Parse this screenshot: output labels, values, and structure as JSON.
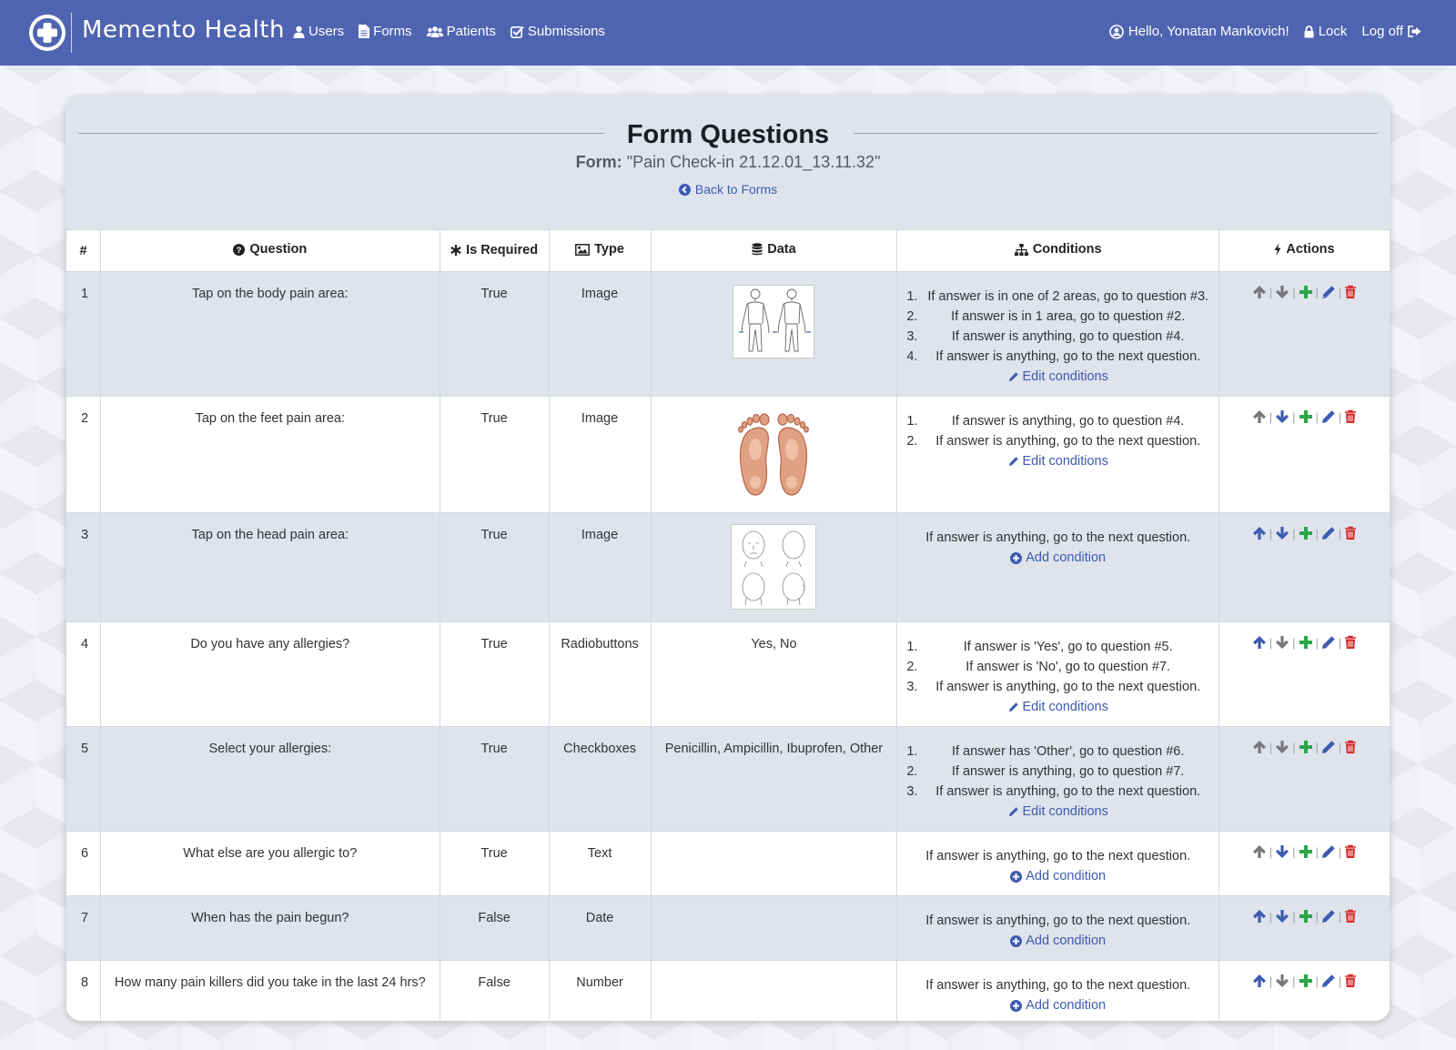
{
  "navbar": {
    "brand": "Memento Health",
    "links": [
      {
        "label": "Users",
        "icon": "user-icon"
      },
      {
        "label": "Forms",
        "icon": "file-icon"
      },
      {
        "label": "Patients",
        "icon": "users-icon"
      },
      {
        "label": "Submissions",
        "icon": "check-square-icon"
      }
    ],
    "greeting": "Hello, Yonatan Mankovich!",
    "lock": "Lock",
    "logoff": "Log off"
  },
  "page": {
    "title": "Form Questions",
    "form_label": "Form:",
    "form_name": "\"Pain Check-in 21.12.01_13.11.32\"",
    "back_link": "Back to Forms"
  },
  "table": {
    "headers": {
      "num": "#",
      "question": "Question",
      "required": "Is Required",
      "type": "Type",
      "data": "Data",
      "conditions": "Conditions",
      "actions": "Actions"
    },
    "rows": [
      {
        "num": "1",
        "question": "Tap on the body pain area:",
        "required": "True",
        "type": "Image",
        "data_image": "body-diagram",
        "conditions": [
          "If answer is in one of 2 areas, go to question #3.",
          "If answer is in 1 area, go to question #2.",
          "If answer is anything, go to question #4.",
          "If answer is anything, go to the next question."
        ],
        "cond_link": "Edit conditions"
      },
      {
        "num": "2",
        "question": "Tap on the feet pain area:",
        "required": "True",
        "type": "Image",
        "data_image": "feet-diagram",
        "conditions": [
          "If answer is anything, go to question #4.",
          "If answer is anything, go to the next question."
        ],
        "cond_link": "Edit conditions"
      },
      {
        "num": "3",
        "question": "Tap on the head pain area:",
        "required": "True",
        "type": "Image",
        "data_image": "head-diagram",
        "condition_single": "If answer is anything, go to the next question.",
        "cond_link": "Add condition"
      },
      {
        "num": "4",
        "question": "Do you have any allergies?",
        "required": "True",
        "type": "Radiobuttons",
        "data": "Yes, No",
        "conditions": [
          "If answer is 'Yes', go to question #5.",
          "If answer is 'No', go to question #7.",
          "If answer is anything, go to the next question."
        ],
        "cond_link": "Edit conditions"
      },
      {
        "num": "5",
        "question": "Select your allergies:",
        "required": "True",
        "type": "Checkboxes",
        "data": "Penicillin, Ampicillin, Ibuprofen, Other",
        "conditions": [
          "If answer has 'Other', go to question #6.",
          "If answer is anything, go to question #7.",
          "If answer is anything, go to the next question."
        ],
        "cond_link": "Edit conditions"
      },
      {
        "num": "6",
        "question": "What else are you allergic to?",
        "required": "True",
        "type": "Text",
        "data": "",
        "condition_single": "If answer is anything, go to the next question.",
        "cond_link": "Add condition"
      },
      {
        "num": "7",
        "question": "When has the pain begun?",
        "required": "False",
        "type": "Date",
        "data": "",
        "condition_single": "If answer is anything, go to the next question.",
        "cond_link": "Add condition"
      },
      {
        "num": "8",
        "question": "How many pain killers did you take in the last 24 hrs?",
        "required": "False",
        "type": "Number",
        "data": "",
        "condition_single": "If answer is anything, go to the next question.",
        "cond_link": "Add condition"
      }
    ]
  },
  "colors": {
    "navbar": "#4f64b1",
    "link": "#3d5bb0",
    "arrow_active": "#3d5bb0",
    "arrow_disabled": "#777777",
    "add": "#2aa64a",
    "delete": "#d62828"
  }
}
